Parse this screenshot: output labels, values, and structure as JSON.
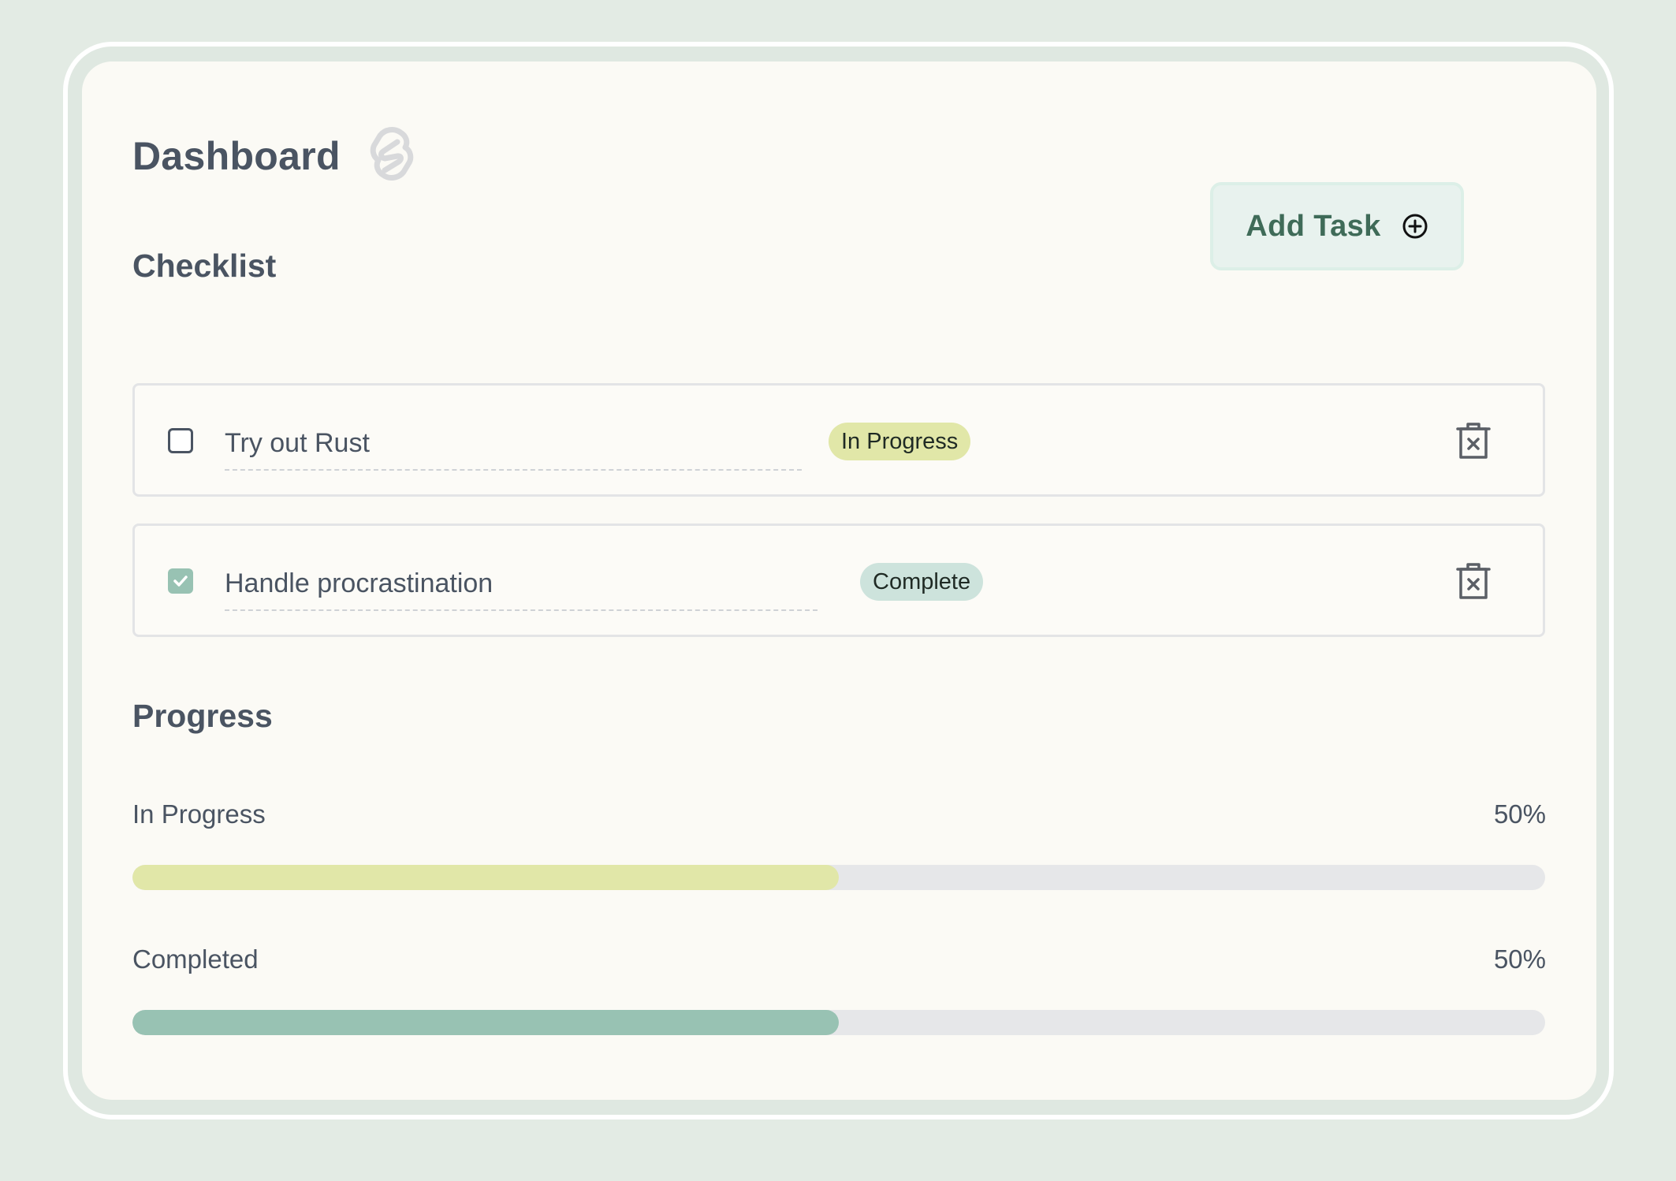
{
  "header": {
    "title": "Dashboard",
    "logo_icon": "svelte-logo-icon"
  },
  "checklist": {
    "title": "Checklist",
    "add_task_label": "Add Task",
    "add_task_icon": "plus-circle-icon",
    "tasks": [
      {
        "text": "Try out Rust",
        "checked": false,
        "status": "In Progress",
        "status_color": "#e1e7a8",
        "delete_icon": "trash-icon"
      },
      {
        "text": "Handle procrastination",
        "checked": true,
        "status": "Complete",
        "status_color": "#cde3dc",
        "delete_icon": "trash-icon"
      }
    ]
  },
  "progress": {
    "title": "Progress",
    "bars": [
      {
        "label": "In Progress",
        "value_text": "50%",
        "fraction": 0.5,
        "color": "#e1e7a8"
      },
      {
        "label": "Completed",
        "value_text": "50%",
        "fraction": 0.5,
        "color": "#98c2b3"
      }
    ]
  },
  "colors": {
    "background": "#e3ebe4",
    "card": "#fbfaf5",
    "text": "#4a5462",
    "accent": "#3f6b58",
    "check": "#98c2b3"
  }
}
